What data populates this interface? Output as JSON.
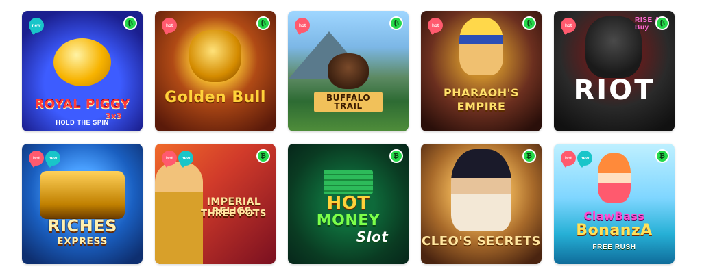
{
  "badges": {
    "hot": "hot",
    "new": "new"
  },
  "coin_icon": "bitcoin-icon",
  "coin_symbol": "₿",
  "games": [
    {
      "title": "ROYAL PIGGY",
      "title2": "3x3",
      "subtitle": "HOLD THE SPIN",
      "badges": [
        "new"
      ]
    },
    {
      "title": "Golden Bull",
      "subtitle": "",
      "badges": [
        "hot"
      ]
    },
    {
      "title": "BUFFALO TRAIL",
      "subtitle": "",
      "badges": [
        "hot"
      ]
    },
    {
      "title": "PHARAOH'S",
      "title2": "EMPIRE",
      "subtitle": "",
      "badges": [
        "hot"
      ]
    },
    {
      "title": "RIOT",
      "subtitle": "RISE & Buy",
      "badges": [
        "hot"
      ]
    },
    {
      "title": "RICHES",
      "title2": "EXPRESS",
      "subtitle": "",
      "badges": [
        "hot",
        "new"
      ]
    },
    {
      "title": "IMPERIAL RELICS:",
      "title2": "THREE POTS",
      "subtitle": "",
      "badges": [
        "hot",
        "new"
      ]
    },
    {
      "title": "HOT",
      "title2": "MONEY",
      "title3": "Slot",
      "subtitle": "",
      "badges": []
    },
    {
      "title": "CLEO'S SECRETS",
      "subtitle": "",
      "badges": []
    },
    {
      "title": "ClawBass",
      "title2": "BonanzA",
      "subtitle": "FREE RUSH",
      "badges": [
        "hot",
        "new"
      ]
    }
  ]
}
